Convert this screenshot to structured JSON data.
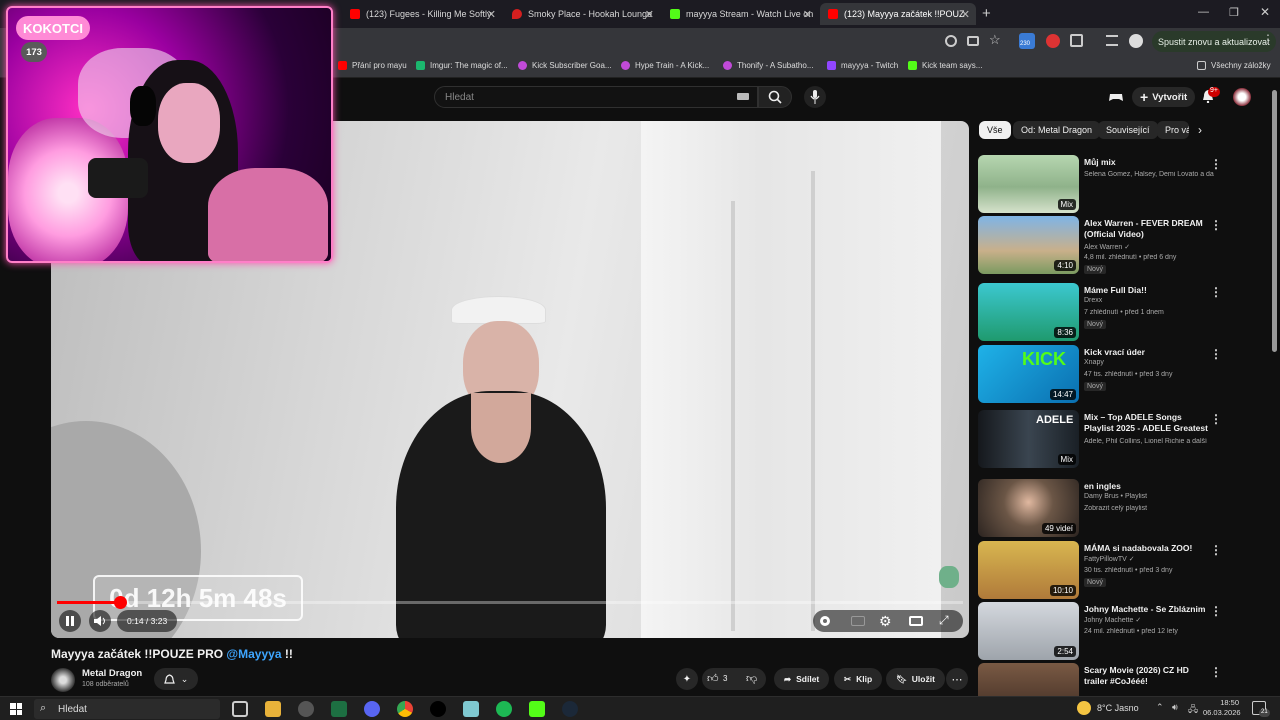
{
  "browser": {
    "tabs": [
      {
        "label": "(123) Fugees - Killing Me Softly",
        "active": false,
        "icon": "youtube-icon",
        "color": "#ff0000"
      },
      {
        "label": "Smoky Place - Hookah Lounge",
        "active": false,
        "icon": "location-pin-icon",
        "color": "#d41f1f"
      },
      {
        "label": "mayyya Stream - Watch Live on",
        "active": false,
        "icon": "kick-icon",
        "color": "#53fc18"
      },
      {
        "label": "(123) Mayyya začátek !!POUZ",
        "active": true,
        "icon": "youtube-icon",
        "color": "#ff0000"
      }
    ],
    "update_button": "Spustit znovu a aktualizovat",
    "ext_badge": "230",
    "bookmarks": [
      {
        "label": "Přání pro mayu",
        "color": "#ff0000"
      },
      {
        "label": "Imgur: The magic of...",
        "color": "#1bb76e"
      },
      {
        "label": "Kick Subscriber Goa...",
        "color": "#c04ad8"
      },
      {
        "label": "Hype Train - A Kick...",
        "color": "#c04ad8"
      },
      {
        "label": "Thonify - A Subatho...",
        "color": "#c04ad8"
      },
      {
        "label": "mayyya - Twitch",
        "color": "#9146ff"
      },
      {
        "label": "Kick team says...",
        "color": "#53fc18"
      }
    ],
    "all_bookmarks": "Všechny záložky"
  },
  "youtube": {
    "search_placeholder": "Hledat",
    "create_label": "Vytvořit",
    "notif_count": "9+",
    "video_title_prefix": "Mayyya začátek !!POUZE PRO",
    "video_title_mention": "@Mayyya",
    "video_title_suffix": "!!",
    "channel_name": "Metal Dragon",
    "subscribers": "108 odběratelů",
    "likes": "3",
    "share_label": "Sdílet",
    "clip_label": "Klip",
    "save_label": "Uložit",
    "time": "0:14 / 3:23",
    "progress_fraction": 0.07,
    "timer_overlay": "0d 12h 5m 48s",
    "chips": [
      {
        "label": "Vše",
        "active": true
      },
      {
        "label": "Od: Metal Dragon",
        "active": false
      },
      {
        "label": "Související",
        "active": false
      },
      {
        "label": "Pro vás",
        "active": false
      }
    ],
    "recommendations": [
      {
        "title": "Můj mix",
        "meta1": "Selena Gomez, Halsey, Demi Lovato a da...",
        "meta2": "",
        "badge": "",
        "duration": "Mix",
        "thumb": "#a6c7a8"
      },
      {
        "title": "Alex Warren - FEVER DREAM (Official Video)",
        "meta1": "Alex Warren ✓",
        "meta2": "4,8 mil. zhlédnutí • před 6 dny",
        "badge": "Nový",
        "duration": "4:10",
        "thumb": "#4e8bc4"
      },
      {
        "title": "Máme Full Dia!!",
        "meta1": "Drexx",
        "meta2": "7 zhlédnutí • před 1 dnem",
        "badge": "Nový",
        "duration": "8:36",
        "thumb": "#2fb58c"
      },
      {
        "title": "Kick vrací úder",
        "meta1": "Xnapy",
        "meta2": "47 tis. zhlédnutí • před 3 dny",
        "badge": "Nový",
        "duration": "14:47",
        "thumb": "#1e9bd7"
      },
      {
        "title": "Mix – Top ADELE Songs Playlist 2025 - ADELE Greatest Hits ...",
        "meta1": "Adele, Phil Collins, Lionel Richie a další",
        "meta2": "",
        "badge": "",
        "duration": "Mix",
        "thumb": "#2a3038"
      },
      {
        "title": "en ingles",
        "meta1": "Damy Brus • Playlist",
        "meta2": "Zobrazit celý playlist",
        "badge": "",
        "duration": "49 videí",
        "thumb": "#6b5646"
      },
      {
        "title": "MÁMA si nadabovala ZOO!",
        "meta1": "FattyPillowTV ✓",
        "meta2": "30 tis. zhlédnutí • před 3 dny",
        "badge": "Nový",
        "duration": "10:10",
        "thumb": "#c79a3c"
      },
      {
        "title": "Johny Machette - Se Zbláznim",
        "meta1": "Johny Machette ✓",
        "meta2": "24 mil. zhlédnutí • před 12 lety",
        "badge": "",
        "duration": "2:54",
        "thumb": "#b8bcc2"
      },
      {
        "title": "Scary Movie (2026) CZ HD trailer #CoJééé!",
        "meta1": "",
        "meta2": "",
        "badge": "",
        "duration": "",
        "thumb": "#5a4030"
      }
    ]
  },
  "overlay": {
    "name": "KOKOTCI",
    "count": "173"
  },
  "taskbar": {
    "search_label": "Hledat",
    "weather": "8°C Jasno",
    "time": "18:50",
    "date": "06.03.2026",
    "notif": "21"
  }
}
